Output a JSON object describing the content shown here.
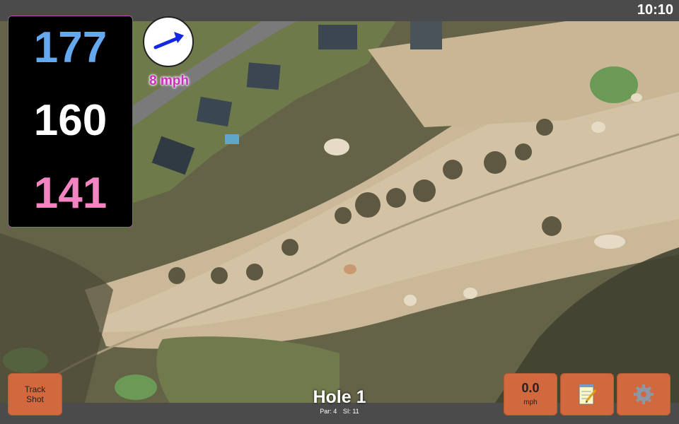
{
  "status": {
    "time": "10:10"
  },
  "distances": {
    "back": "177",
    "middle": "160",
    "front": "141"
  },
  "wind": {
    "speed_label": "8 mph",
    "direction_icon": "arrow-icon"
  },
  "hole": {
    "title": "Hole 1",
    "par": "Par: 4",
    "stroke_index": "SI: 11"
  },
  "buttons": {
    "track_line1": "Track",
    "track_line2": "Shot",
    "speed_value": "0.0",
    "speed_unit": "mph",
    "notes_icon": "notepad-icon",
    "settings_icon": "gear-icon"
  },
  "colors": {
    "back": "#64a9f0",
    "middle": "#ffffff",
    "front": "#f384c2",
    "button": "#d2693e",
    "wind_text": "#cc2cbe"
  }
}
